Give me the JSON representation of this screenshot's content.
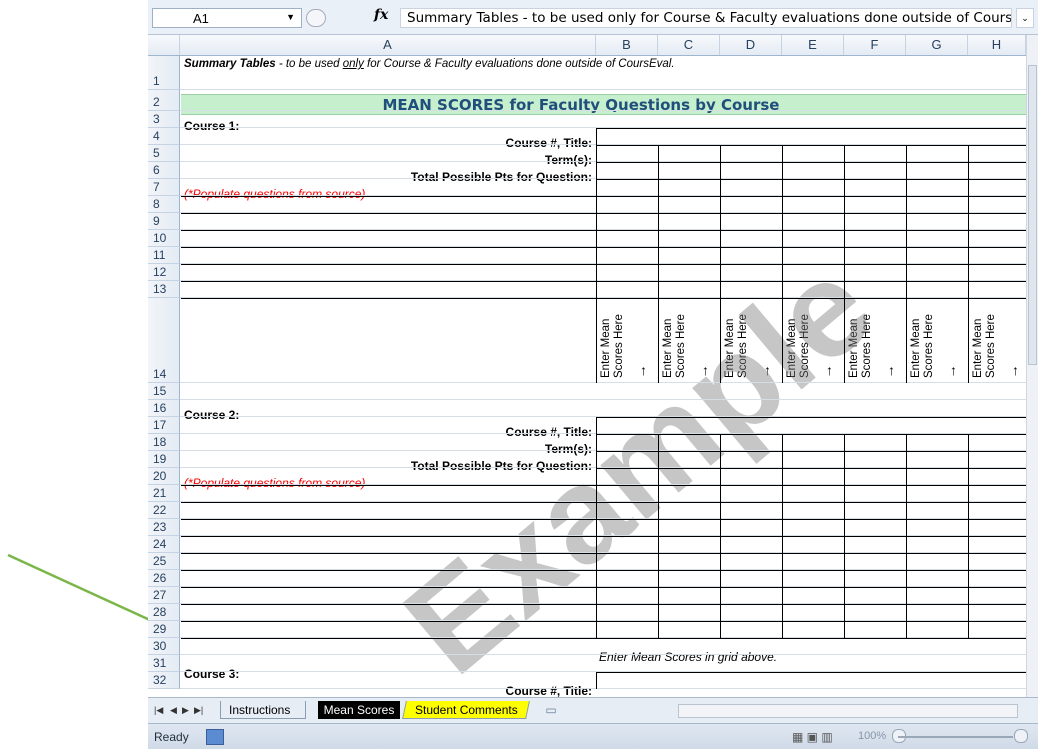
{
  "formula_bar": {
    "name_box": "A1",
    "fx": "fx",
    "formula": "Summary Tables - to be used only for Course & Faculty evaluations done outside of CoursEval."
  },
  "columns": [
    "A",
    "B",
    "C",
    "D",
    "E",
    "F",
    "G",
    "H"
  ],
  "rows": [
    "1",
    "2",
    "3",
    "4",
    "5",
    "6",
    "7",
    "8",
    "9",
    "10",
    "11",
    "12",
    "13",
    "14",
    "15",
    "16",
    "17",
    "18",
    "19",
    "20",
    "21",
    "22",
    "23",
    "24",
    "25",
    "26",
    "27",
    "28",
    "29",
    "30",
    "31",
    "32"
  ],
  "sheet": {
    "note_bold": "Summary Tables",
    "note_mid": " - to be used ",
    "note_underline": "only",
    "note_tail": " for Course & Faculty evaluations done outside of CoursEval.",
    "banner": "MEAN SCORES for Faculty Questions by Course",
    "course1": "Course 1:",
    "course2": "Course 2:",
    "course3": "Course 3:",
    "course_title_label": "Course #, Title:",
    "term_label": "Term(s):",
    "total_label": "Total Possible Pts for Question:",
    "populate_note": "(*Populate questions from source)",
    "enter_mean_vertical": "Enter Mean\nScores Here",
    "enter_grid_note": "Enter Mean Scores in grid above.",
    "watermark": "Example"
  },
  "tabs": {
    "instructions": "Instructions",
    "mean_scores": "Mean Scores",
    "student_comments": "Student Comments"
  },
  "status": {
    "ready": "Ready",
    "zoom": "100%"
  },
  "colors": {
    "banner_bg": "#c6efce",
    "populate_note": "#ff0000",
    "student_tab": "#ffff00",
    "arrow": "#7ab648"
  }
}
